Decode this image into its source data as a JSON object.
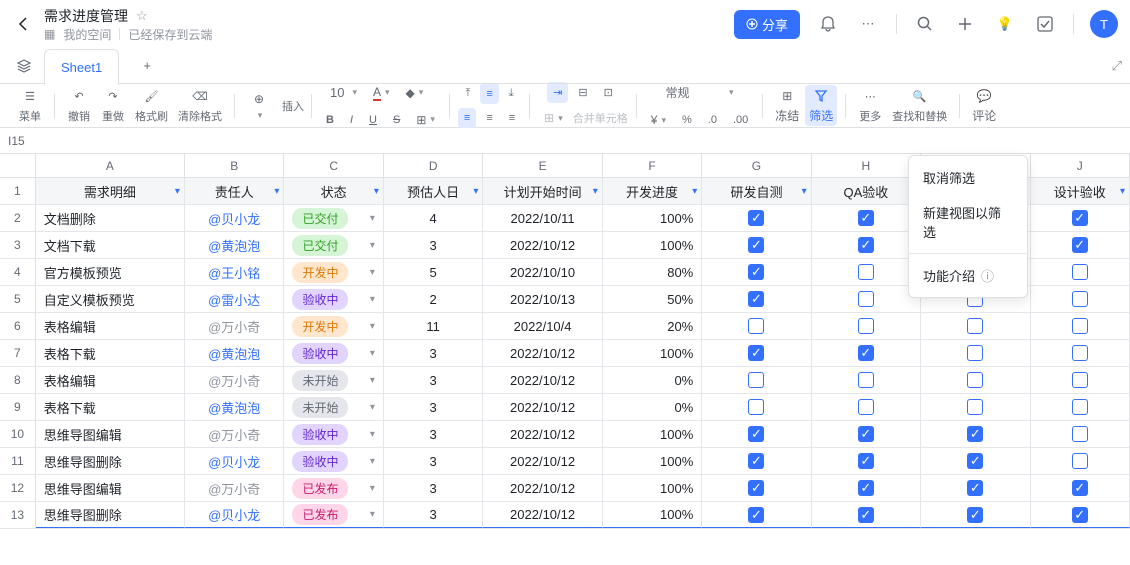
{
  "header": {
    "title": "需求进度管理",
    "folder": "我的空间",
    "save_status": "已经保存到云端",
    "share_label": "分享",
    "avatar_letter": "T"
  },
  "tabs": {
    "sheet1": "Sheet1"
  },
  "toolbar": {
    "menu": "菜单",
    "undo": "撤销",
    "redo": "重做",
    "paint": "格式刷",
    "clear": "清除格式",
    "insert": "插入",
    "fontsize": "10",
    "bold": "B",
    "italic": "I",
    "underline": "U",
    "strike": "S",
    "merge": "合并单元格",
    "format": "常规",
    "freeze": "冻结",
    "filter": "筛选",
    "more": "更多",
    "findreplace": "查找和替换",
    "comment": "评论"
  },
  "cellref": "I15",
  "columns": [
    "A",
    "B",
    "C",
    "D",
    "E",
    "F",
    "G",
    "H",
    "I",
    "J"
  ],
  "headers": [
    "需求明细",
    "责任人",
    "状态",
    "预估人日",
    "计划开始时间",
    "开发进度",
    "研发自测",
    "QA验收",
    "",
    "设计验收"
  ],
  "dropdown": {
    "cancel_filter": "取消筛选",
    "new_view_filter": "新建视图以筛选",
    "feature_intro": "功能介绍"
  },
  "status_labels": {
    "delivered": "已交付",
    "developing": "开发中",
    "testing": "验收中",
    "notstarted": "未开始",
    "published": "已发布"
  },
  "rows": [
    {
      "n": 2,
      "req": "文档删除",
      "owner": "@贝小龙",
      "owner_gray": false,
      "status": "delivered",
      "days": "4",
      "date": "2022/10/11",
      "progress": "100%",
      "g": true,
      "h": true,
      "i": true,
      "j": true
    },
    {
      "n": 3,
      "req": "文档下载",
      "owner": "@黄泡泡",
      "owner_gray": false,
      "status": "delivered",
      "days": "3",
      "date": "2022/10/12",
      "progress": "100%",
      "g": true,
      "h": true,
      "i": true,
      "j": true
    },
    {
      "n": 4,
      "req": "官方模板预览",
      "owner": "@王小铭",
      "owner_gray": false,
      "status": "developing",
      "days": "5",
      "date": "2022/10/10",
      "progress": "80%",
      "g": true,
      "h": false,
      "i": false,
      "j": false
    },
    {
      "n": 5,
      "req": "自定义模板预览",
      "owner": "@雷小达",
      "owner_gray": false,
      "status": "testing",
      "days": "2",
      "date": "2022/10/13",
      "progress": "50%",
      "g": true,
      "h": false,
      "i": false,
      "j": false
    },
    {
      "n": 6,
      "req": "表格编辑",
      "owner": "@万小奇",
      "owner_gray": true,
      "status": "developing",
      "days": "11",
      "date": "2022/10/4",
      "progress": "20%",
      "g": false,
      "h": false,
      "i": false,
      "j": false
    },
    {
      "n": 7,
      "req": "表格下载",
      "owner": "@黄泡泡",
      "owner_gray": false,
      "status": "testing",
      "days": "3",
      "date": "2022/10/12",
      "progress": "100%",
      "g": true,
      "h": true,
      "i": false,
      "j": false
    },
    {
      "n": 8,
      "req": "表格编辑",
      "owner": "@万小奇",
      "owner_gray": true,
      "status": "notstarted",
      "days": "3",
      "date": "2022/10/12",
      "progress": "0%",
      "g": false,
      "h": false,
      "i": false,
      "j": false
    },
    {
      "n": 9,
      "req": "表格下载",
      "owner": "@黄泡泡",
      "owner_gray": false,
      "status": "notstarted",
      "days": "3",
      "date": "2022/10/12",
      "progress": "0%",
      "g": false,
      "h": false,
      "i": false,
      "j": false
    },
    {
      "n": 10,
      "req": "思维导图编辑",
      "owner": "@万小奇",
      "owner_gray": true,
      "status": "testing",
      "days": "3",
      "date": "2022/10/12",
      "progress": "100%",
      "g": true,
      "h": true,
      "i": true,
      "j": false
    },
    {
      "n": 11,
      "req": "思维导图删除",
      "owner": "@贝小龙",
      "owner_gray": false,
      "status": "testing",
      "days": "3",
      "date": "2022/10/12",
      "progress": "100%",
      "g": true,
      "h": true,
      "i": true,
      "j": false
    },
    {
      "n": 12,
      "req": "思维导图编辑",
      "owner": "@万小奇",
      "owner_gray": true,
      "status": "published",
      "days": "3",
      "date": "2022/10/12",
      "progress": "100%",
      "g": true,
      "h": true,
      "i": true,
      "j": true
    },
    {
      "n": 13,
      "req": "思维导图删除",
      "owner": "@贝小龙",
      "owner_gray": false,
      "status": "published",
      "days": "3",
      "date": "2022/10/12",
      "progress": "100%",
      "g": true,
      "h": true,
      "i": true,
      "j": true
    }
  ]
}
